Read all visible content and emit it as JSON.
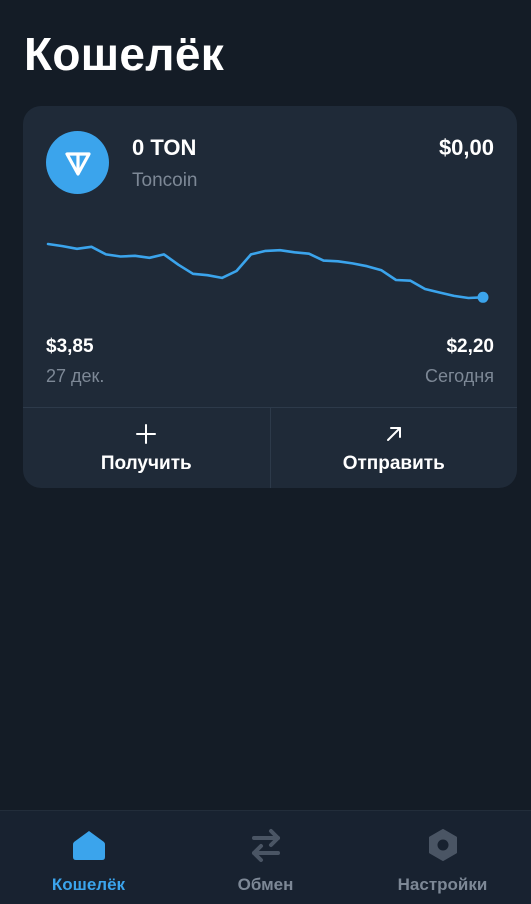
{
  "header": {
    "title": "Кошелёк"
  },
  "wallet_card": {
    "coin_icon": "ton-diamond-icon",
    "balance": "0 TON",
    "coin_name": "Toncoin",
    "fiat_value": "$0,00",
    "chart": {
      "type": "line",
      "start_price_label": "$3,85",
      "start_date_label": "27 дек.",
      "end_price_label": "$2,20",
      "end_date_label": "Сегодня",
      "values": [
        3.85,
        3.82,
        3.78,
        3.81,
        3.7,
        3.67,
        3.68,
        3.65,
        3.7,
        3.55,
        3.42,
        3.4,
        3.36,
        3.46,
        3.7,
        3.75,
        3.76,
        3.73,
        3.71,
        3.61,
        3.6,
        3.57,
        3.53,
        3.47,
        3.33,
        3.32,
        3.2,
        3.15,
        3.1,
        3.07,
        3.08
      ]
    },
    "actions": {
      "receive": {
        "label": "Получить",
        "icon": "plus-icon"
      },
      "send": {
        "label": "Отправить",
        "icon": "arrow-up-right-icon"
      }
    }
  },
  "tabbar": {
    "tabs": [
      {
        "label": "Кошелёк",
        "icon": "home-icon",
        "active": true
      },
      {
        "label": "Обмен",
        "icon": "swap-arrows-icon",
        "active": false
      },
      {
        "label": "Настройки",
        "icon": "settings-hexagon-icon",
        "active": false
      }
    ]
  },
  "colors": {
    "background": "#141c26",
    "card": "#1f2a38",
    "accent": "#3ba4ec",
    "muted_text": "#7d8896",
    "inactive_icon": "#4a5564"
  }
}
